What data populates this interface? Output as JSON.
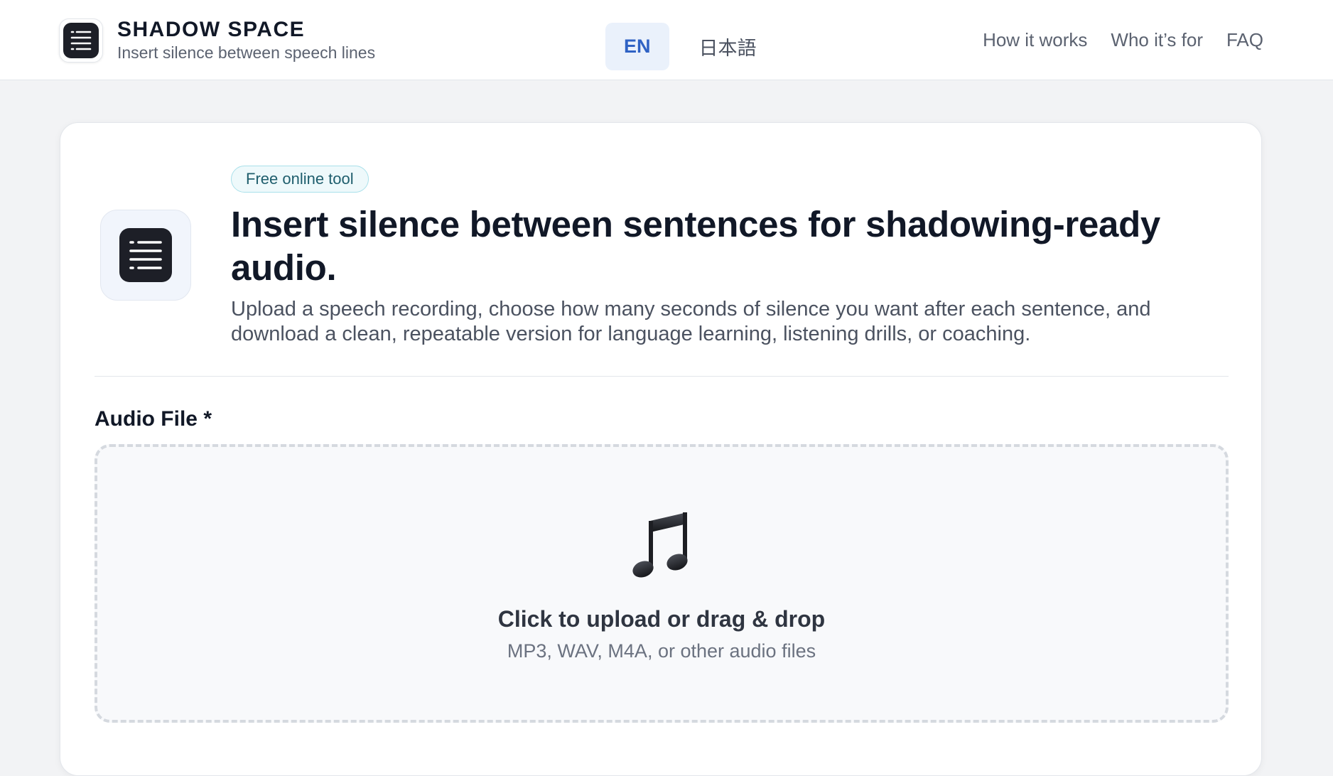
{
  "header": {
    "brand_title": "SHADOW SPACE",
    "brand_subtitle": "Insert silence between speech lines",
    "logo_icon": "text-lines-icon",
    "languages": [
      {
        "label": "EN",
        "active": true
      },
      {
        "label": "日本語",
        "active": false
      }
    ],
    "nav": [
      "How it works",
      "Who it’s for",
      "FAQ"
    ]
  },
  "hero": {
    "badge": "Free online tool",
    "title": "Insert silence between sentences for shadowing-ready audio.",
    "description": "Upload a speech recording, choose how many seconds of silence you want after each sentence, and download a clean, repeatable version for language learning, listening drills, or coaching.",
    "icon": "text-lines-icon"
  },
  "upload": {
    "label": "Audio File *",
    "icon": "music-note-icon",
    "title": "Click to upload or drag & drop",
    "subtitle": "MP3, WAV, M4A, or other audio files"
  },
  "colors": {
    "accent": "#2f62c4",
    "badge_border": "#a9e0ea",
    "logo_dark": "#1d1f27"
  }
}
